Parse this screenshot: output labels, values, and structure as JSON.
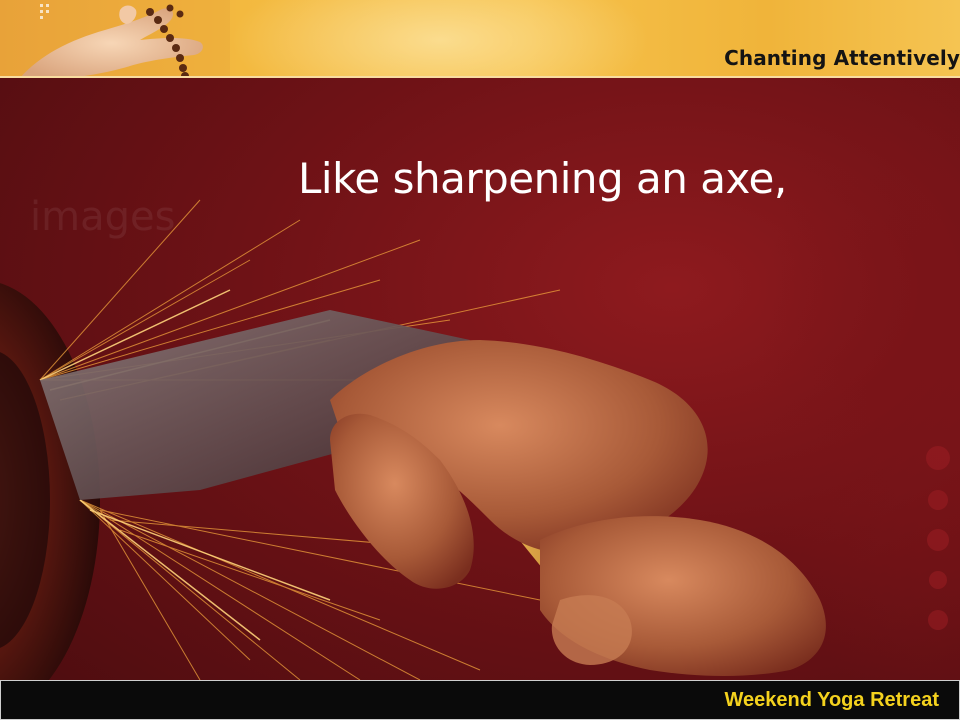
{
  "header": {
    "title": "Chanting Attentively"
  },
  "slide": {
    "main_text": "Like sharpening an axe,",
    "watermark_text": "images"
  },
  "footer": {
    "label": "Weekend Yoga Retreat"
  },
  "colors": {
    "header_gold": "#f3b93f",
    "background_red": "#6e1216",
    "footer_black": "#0a0a0a",
    "footer_text_yellow": "#f4d21e",
    "main_text_white": "#ffffff"
  }
}
